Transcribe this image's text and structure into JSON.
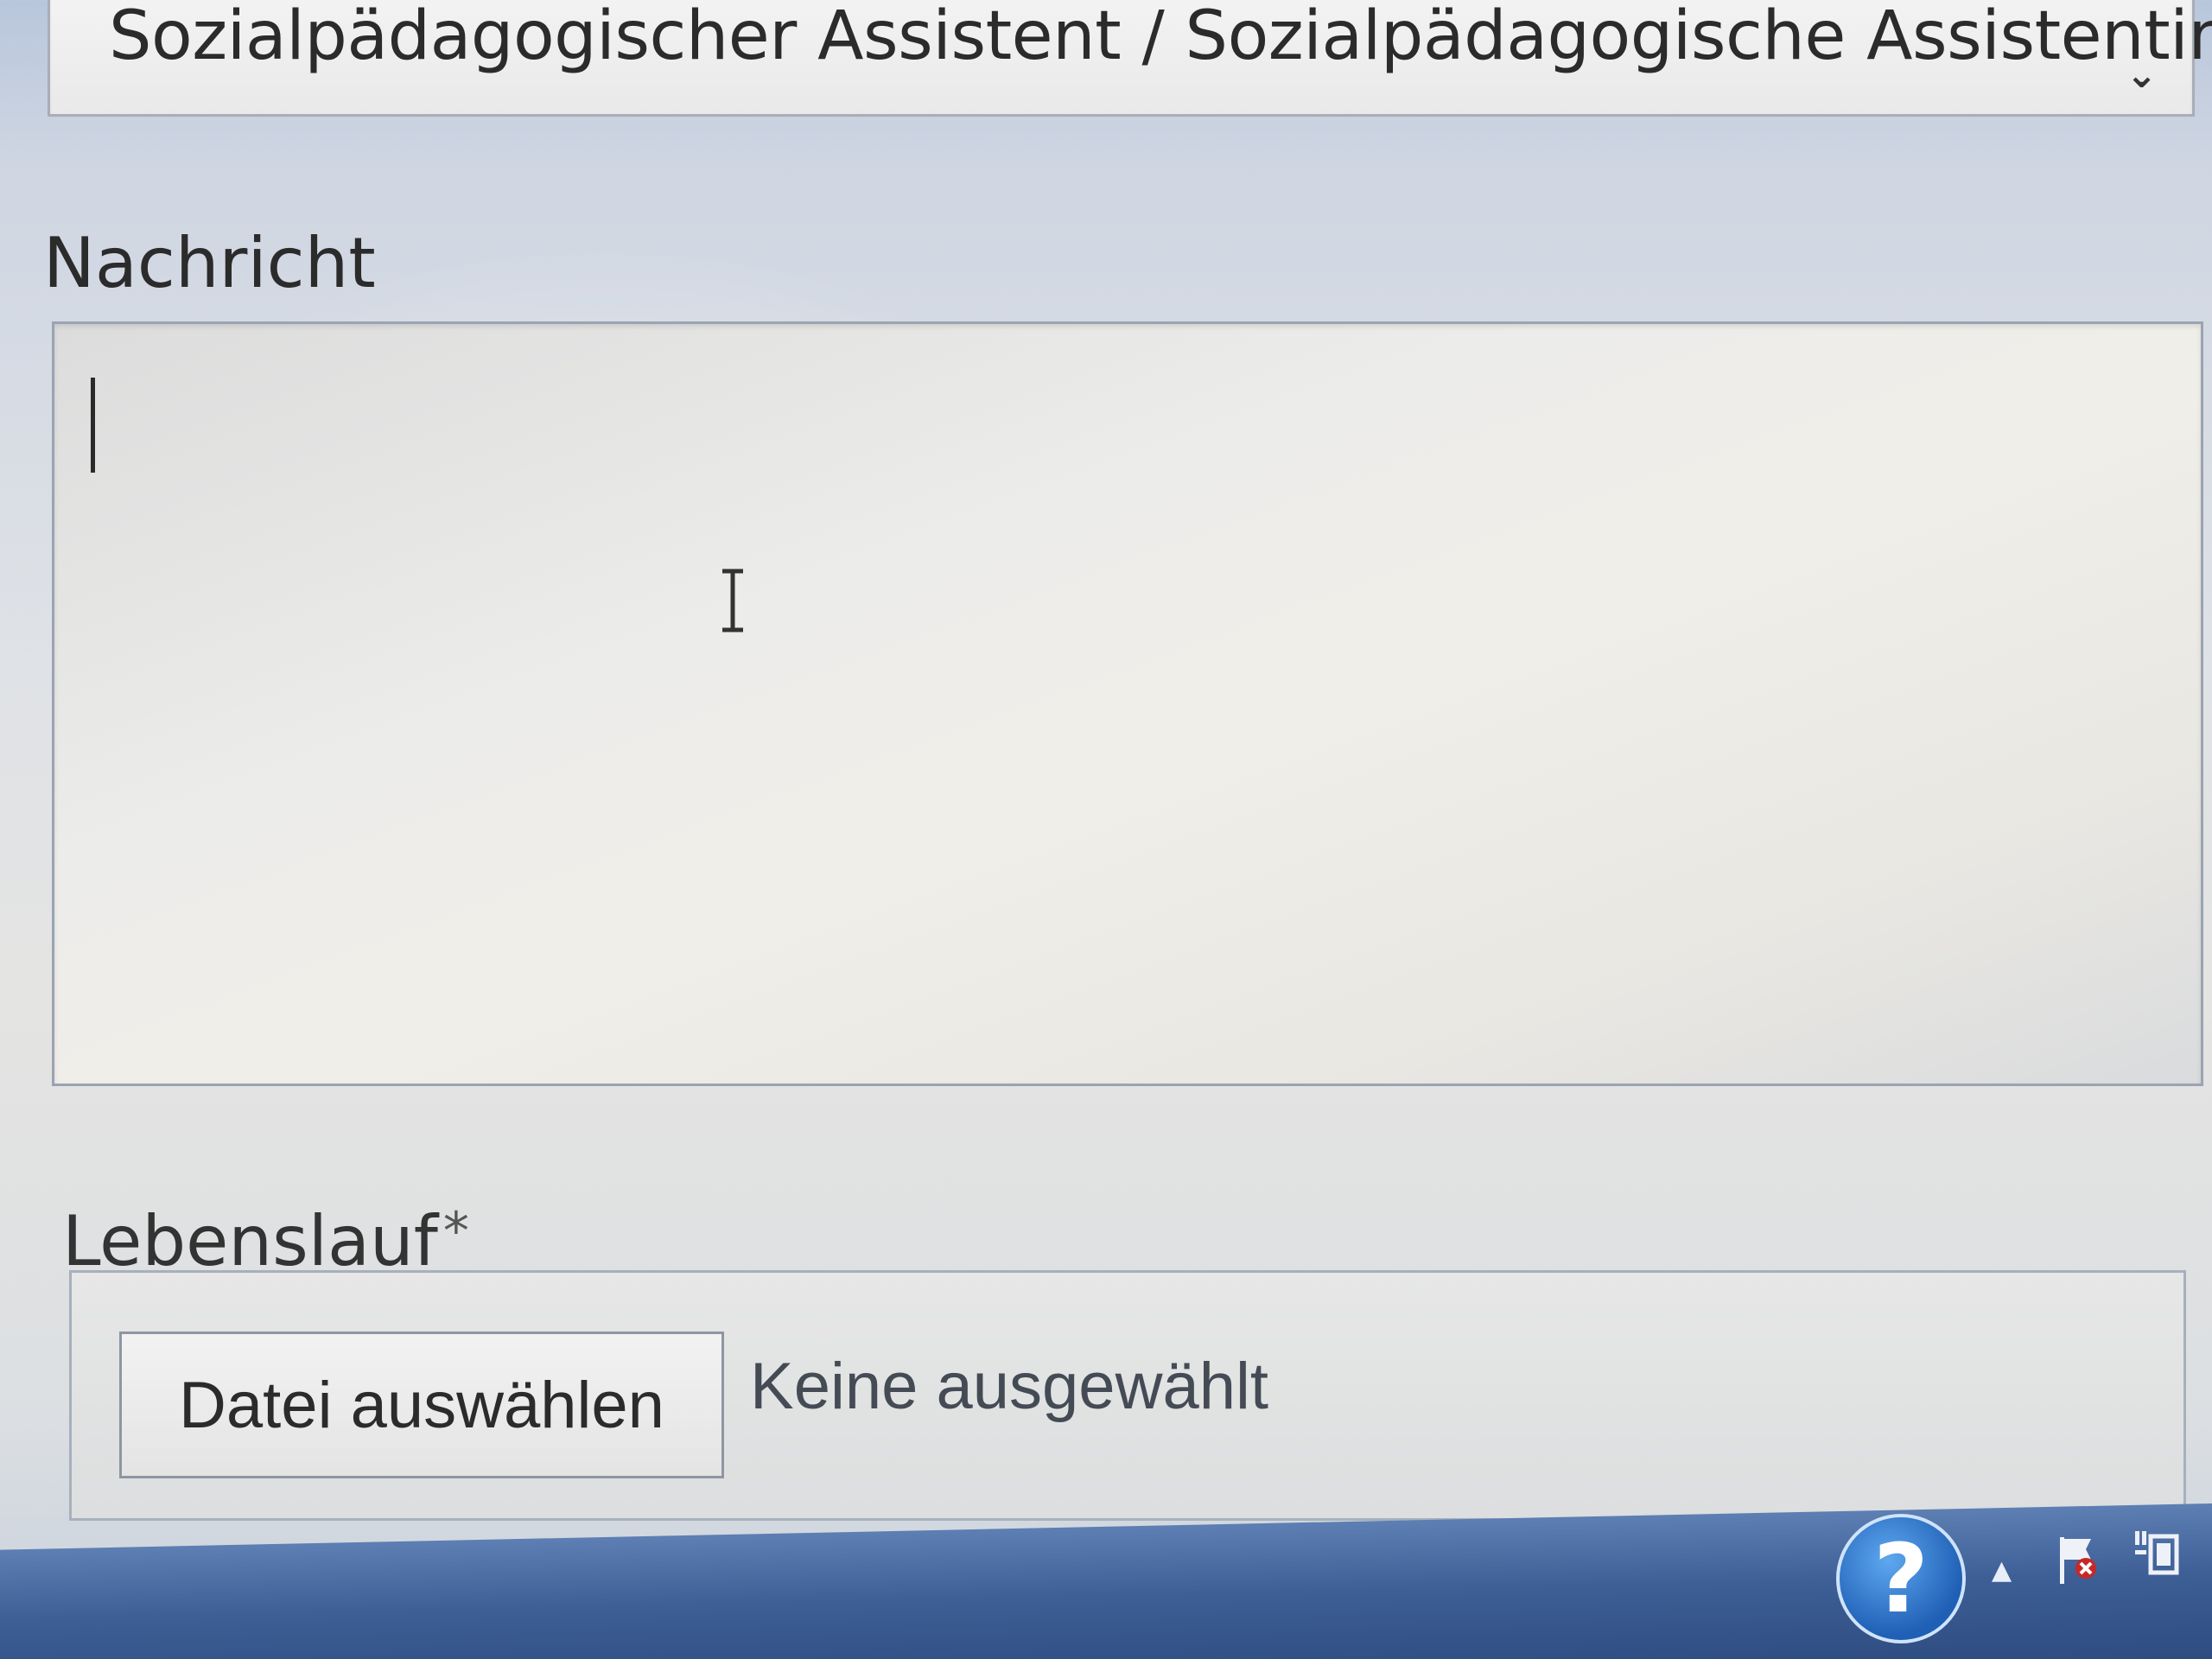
{
  "form": {
    "position_select": {
      "selected_value": "Sozialpädagogischer Assistent / Sozialpädagogische Assistentin (S",
      "icon": "chevron-down-icon"
    },
    "message": {
      "label": "Nachricht",
      "value": ""
    },
    "cv": {
      "label": "Lebenslauf",
      "required_marker": "*",
      "button_label": "Datei auswählen",
      "status_text": "Keine ausgewählt"
    }
  },
  "taskbar": {
    "help_glyph": "?",
    "tray_arrow_glyph": "▲",
    "icons": [
      "help-icon",
      "tray-arrow-icon",
      "action-center-flag-icon",
      "network-icon"
    ]
  },
  "colors": {
    "taskbar": "#3d5f96",
    "help_icon": "#1f5fb5",
    "input_border": "#9aa4b2"
  }
}
